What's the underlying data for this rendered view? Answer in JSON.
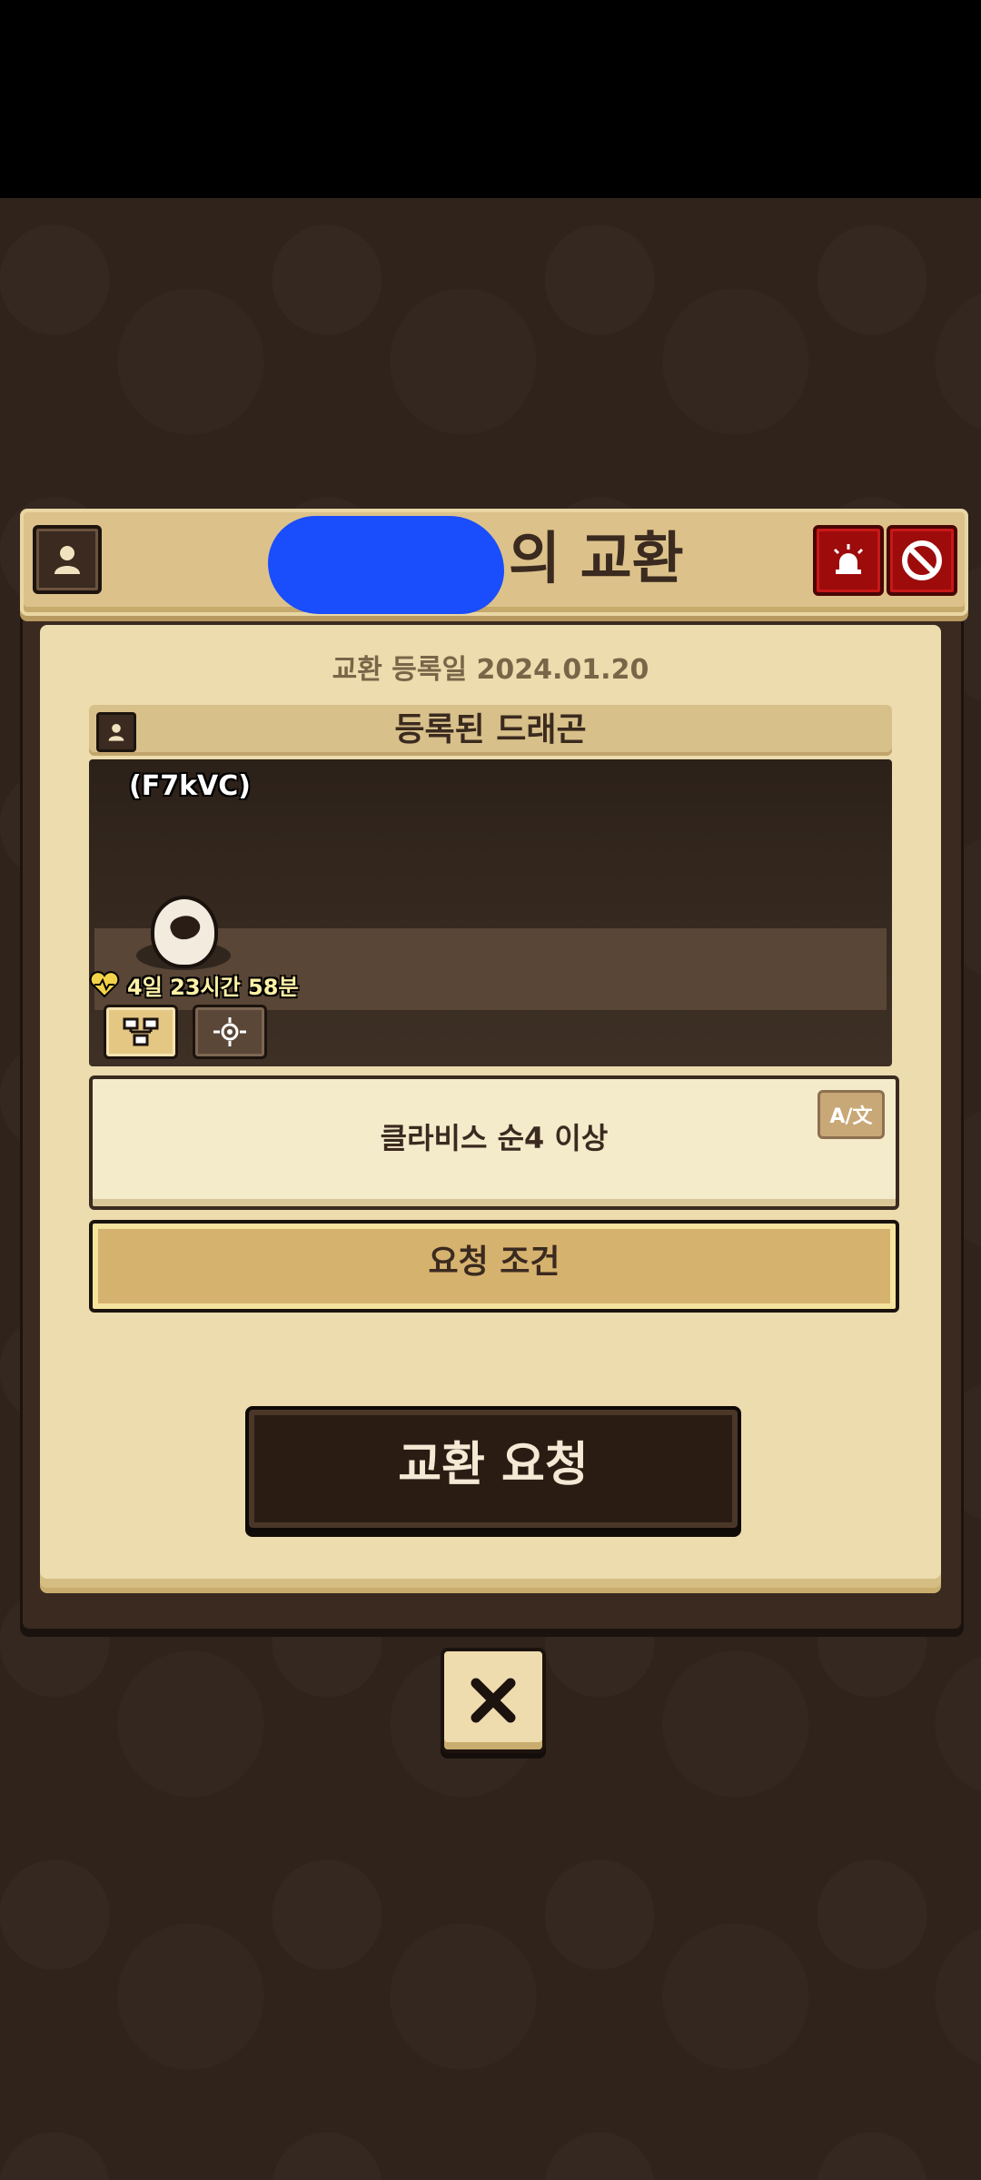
{
  "header": {
    "title_suffix": "의 교환"
  },
  "trade": {
    "registered_date_label": "교환 등록일 2024.01.20",
    "section_title": "등록된 드래곤"
  },
  "dragon": {
    "name": "(F7kVC)",
    "timer": "4일 23시간 58분"
  },
  "condition": {
    "text": "클라비스 순4 이상",
    "translate_label": "A/文"
  },
  "buttons": {
    "request_condition": "요청 조건",
    "exchange_request": "교환 요청",
    "close": "✖"
  },
  "colors": {
    "redacted_blob": "#1a4dfb",
    "alert_red": "#9e0b0b",
    "paper": "#ecdcae"
  }
}
